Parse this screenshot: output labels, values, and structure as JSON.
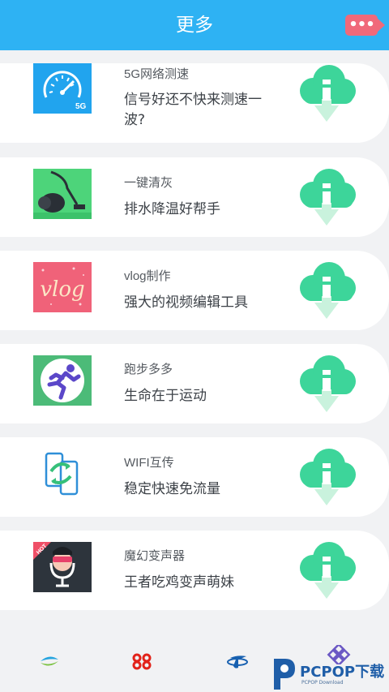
{
  "header": {
    "title": "更多",
    "more_icon": "more-dots-icon",
    "more_label": "•••"
  },
  "apps": [
    {
      "name": "5G网络测速",
      "desc": "信号好还不快来测速一波?",
      "icon": "speedometer-5g-icon"
    },
    {
      "name": "一键清灰",
      "desc": "排水降温好帮手",
      "icon": "vacuum-cleaner-icon"
    },
    {
      "name": "vlog制作",
      "desc": "强大的视频编辑工具",
      "icon": "vlog-logo-icon",
      "icon_text": "vlog"
    },
    {
      "name": "跑步多多",
      "desc": "生命在于运动",
      "icon": "running-man-icon"
    },
    {
      "name": "WIFI互传",
      "desc": "稳定快速免流量",
      "icon": "phone-transfer-icon"
    },
    {
      "name": "魔幻变声器",
      "desc": "王者吃鸡变声萌妹",
      "icon": "voice-changer-icon",
      "icon_badge": "HOT"
    }
  ],
  "download_icon": "cloud-download-icon",
  "carriers": [
    "china-mobile-logo",
    "china-unicom-logo",
    "china-telecom-logo",
    "carrier-diamond-logo"
  ],
  "watermark": {
    "text": "PCPOP下载",
    "sub": "PCPOP Download"
  },
  "colors": {
    "header": "#2eb2f3",
    "more_button": "#f0697a",
    "download_green": "#3dd59a",
    "background": "#f1f2f4"
  }
}
